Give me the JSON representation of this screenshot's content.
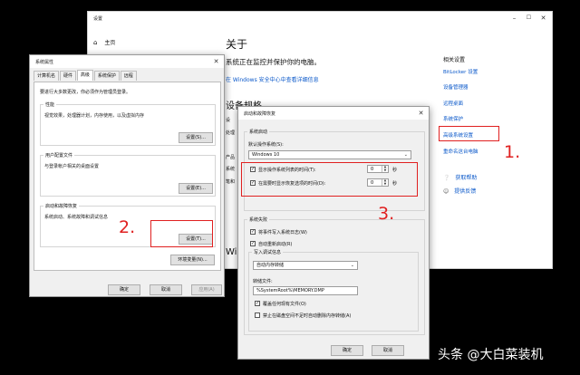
{
  "settings": {
    "title": "设置",
    "home": "主页",
    "about": "关于",
    "protect_text": "系统正在监控并保护你的电脑。",
    "security_link": "在 Windows 安全中心中查看详细信息",
    "specs_heading": "设备规格",
    "specs_rows": [
      "设",
      "处理",
      "",
      "产品",
      "系统",
      "笔和"
    ],
    "windows_heading_fragment": "Wi",
    "related_heading": "相关设置",
    "related_links": [
      "BitLocker 设置",
      "设备管理器",
      "远程桌面",
      "系统保护",
      "高级系统设置",
      "重命名这台电脑"
    ],
    "help_links": [
      "获取帮助",
      "提供反馈"
    ]
  },
  "sysprop": {
    "title": "系统属性",
    "tabs": [
      "计算机名",
      "硬件",
      "高级",
      "系统保护",
      "远程"
    ],
    "admin_note": "要进行大多数更改，你必须作为管理员登录。",
    "performance": {
      "header": "性能",
      "desc": "视觉效果，处理器计划，内存使用，以及虚拟内存",
      "button": "设置(S)..."
    },
    "user_profiles": {
      "header": "用户配置文件",
      "desc": "与登录帐户相关的桌面设置",
      "button": "设置(E)..."
    },
    "startup_recovery": {
      "header": "启动和故障恢复",
      "desc": "系统启动、系统故障和调试信息",
      "button": "设置(T)..."
    },
    "env_button": "环境变量(N)...",
    "ok": "确定",
    "cancel": "取消",
    "apply": "应用(A)"
  },
  "startup": {
    "title": "启动和故障恢复",
    "system_startup": "系统启动",
    "default_os_label": "默认操作系统(S):",
    "default_os_value": "Windows 10",
    "show_list_label": "显示操作系统列表的时间(T):",
    "show_list_value": "0",
    "show_recovery_label": "在需要时显示恢复选项的时间(D):",
    "show_recovery_value": "0",
    "seconds": "秒",
    "system_failure": "系统失败",
    "write_event": "将事件写入系统日志(W)",
    "auto_restart": "自动重新启动(R)",
    "write_debug": "写入调试信息",
    "debug_value": "自动内存转储",
    "dump_file_label": "转储文件:",
    "dump_file_value": "%SystemRoot%\\MEMORY.DMP",
    "overwrite": "覆盖任何现有文件(O)",
    "disable_auto_delete": "禁止在磁盘空间不足时自动删除内存转储(A)",
    "ok": "确定",
    "cancel": "取消"
  },
  "annotations": {
    "one": "1.",
    "two": "2.",
    "three": "3.",
    "color": "#e02020"
  },
  "watermark": "头条 @大白菜装机"
}
